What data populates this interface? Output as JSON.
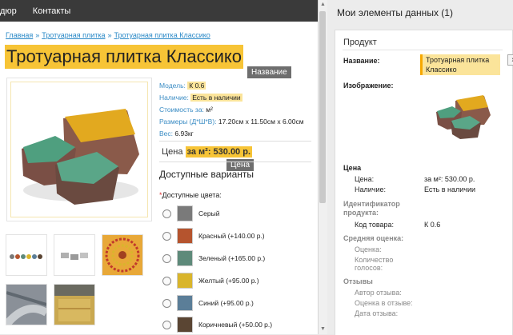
{
  "nav": {
    "items": [
      "дюр",
      "Контакты"
    ]
  },
  "breadcrumb": [
    "Главная",
    "Тротуарная плитка",
    "Тротуарная плитка Классико"
  ],
  "product": {
    "title": "Тротуарная плитка Классико",
    "attrs": [
      {
        "k": "Модель:",
        "v": "К 0.6",
        "hl": true
      },
      {
        "k": "Наличие:",
        "v": "Есть в наличии",
        "hl": true
      },
      {
        "k": "Стоимость за:",
        "v": "м²",
        "hl": false
      },
      {
        "k": "Размеры (Д*Ш*В):",
        "v": "17.20см x 11.50см x 6.00см",
        "hl": false
      },
      {
        "k": "Вес:",
        "v": "6.93кг",
        "hl": false
      }
    ],
    "price_label": "Цена",
    "price_value": "за м²: 530.00 р.",
    "options_title": "Доступные варианты",
    "colors_title": "Доступные цвета:",
    "colors": [
      {
        "name": "Серый",
        "color": "#7a7a7a"
      },
      {
        "name": "Красный (+140.00 р.)",
        "color": "#b5542e"
      },
      {
        "name": "Зеленый (+165.00 р.)",
        "color": "#5e8a7a"
      },
      {
        "name": "Желтый (+95.00 р.)",
        "color": "#d9b52c"
      },
      {
        "name": "Синий (+95.00 р.)",
        "color": "#5b7e98"
      },
      {
        "name": "Коричневый (+50.00 р.)",
        "color": "#5a4533"
      }
    ]
  },
  "tooltips": {
    "name": "Название",
    "price": "Цена"
  },
  "panel": {
    "title": "Мои элементы данных (1)",
    "card_title": "Продукт",
    "name_label": "Название:",
    "name_value": "Тротуарная плитка Классико",
    "remove_label": "x",
    "image_label": "Изображение:",
    "price_section": "Цена",
    "price_label": "Цена:",
    "price_value": "за м²: 530.00 р.",
    "stock_label": "Наличие:",
    "stock_value": "Есть в наличии",
    "id_section": "Идентификатор продукта:",
    "code_label": "Код товара:",
    "code_value": "К 0.6",
    "rating_section": "Средняя оценка:",
    "rating_sub1": "Оценка:",
    "rating_sub2": "Количество голосов:",
    "reviews_section": "Отзывы",
    "review_sub1": "Автор отзыва:",
    "review_sub2": "Оценка в отзыве:",
    "review_sub3": "Дата отзыва:"
  },
  "colors": {
    "accent": "#f7c436",
    "link": "#2a89c7",
    "nav_bg": "#3a3a3a"
  }
}
